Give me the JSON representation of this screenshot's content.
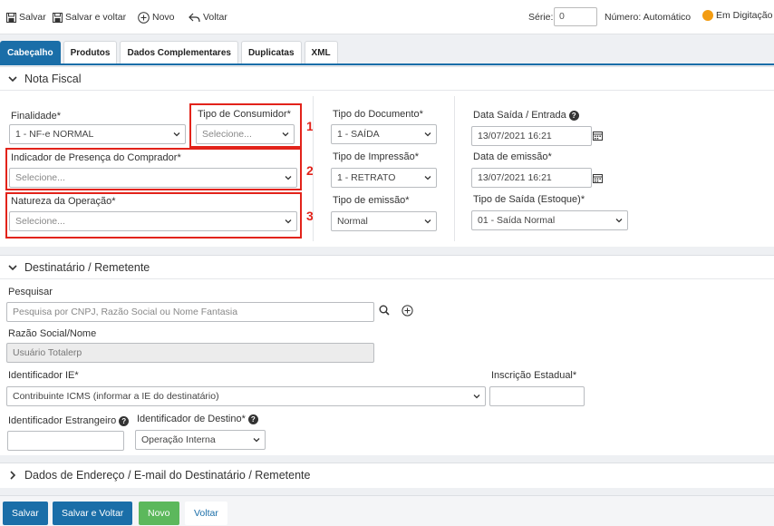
{
  "toolbar": {
    "salvar": "Salvar",
    "salvar_voltar": "Salvar e voltar",
    "novo": "Novo",
    "voltar": "Voltar",
    "serie_label": "Série:",
    "serie_value": "0",
    "numero": "Número: Automático",
    "status": "Em Digitação",
    "status_color": "#f39c12"
  },
  "tabs": [
    "Cabeçalho",
    "Produtos",
    "Dados Complementares",
    "Duplicatas",
    "XML"
  ],
  "nota_fiscal": {
    "title": "Nota Fiscal",
    "finalidade_label": "Finalidade*",
    "finalidade_value": "1 - NF-e NORMAL",
    "tipo_consumidor_label": "Tipo de Consumidor*",
    "tipo_consumidor_value": "Selecione...",
    "presenca_label": "Indicador de Presença do Comprador*",
    "presenca_value": "Selecione...",
    "natureza_label": "Natureza da Operação*",
    "natureza_value": "Selecione...",
    "tipo_documento_label": "Tipo do Documento*",
    "tipo_documento_value": "1 - SAÍDA",
    "tipo_impressao_label": "Tipo de Impressão*",
    "tipo_impressao_value": "1 - RETRATO",
    "tipo_emissao_label": "Tipo de emissão*",
    "tipo_emissao_value": "Normal",
    "data_saida_label": "Data Saída / Entrada",
    "data_saida_value": "13/07/2021 16:21",
    "data_emissao_label": "Data de emissão*",
    "data_emissao_value": "13/07/2021 16:21",
    "tipo_saida_label": "Tipo de Saída (Estoque)*",
    "tipo_saida_value": "01 - Saída Normal",
    "annotations": [
      "1",
      "2",
      "3"
    ],
    "annotation_color": "#e2231a"
  },
  "destinatario": {
    "title": "Destinatário / Remetente",
    "pesquisar_label": "Pesquisar",
    "pesquisar_placeholder": "Pesquisa por CNPJ, Razão Social ou Nome Fantasia",
    "razao_label": "Razão Social/Nome",
    "razao_value": "Usuário Totalerp",
    "ie_label": "Identificador IE*",
    "ie_value": "Contribuinte ICMS (informar a IE do destinatário)",
    "inscricao_label": "Inscrição Estadual*",
    "inscricao_value": "",
    "estrangeiro_label": "Identificador Estrangeiro",
    "estrangeiro_value": "",
    "destino_label": "Identificador de Destino*",
    "destino_value": "Operação Interna"
  },
  "endereco": {
    "title": "Dados de Endereço / E-mail do Destinatário / Remetente"
  },
  "footer": {
    "salvar": "Salvar",
    "salvar_voltar": "Salvar e Voltar",
    "novo": "Novo",
    "voltar": "Voltar",
    "primary_color": "#1a6ea8",
    "novo_color": "#5cb85c"
  }
}
